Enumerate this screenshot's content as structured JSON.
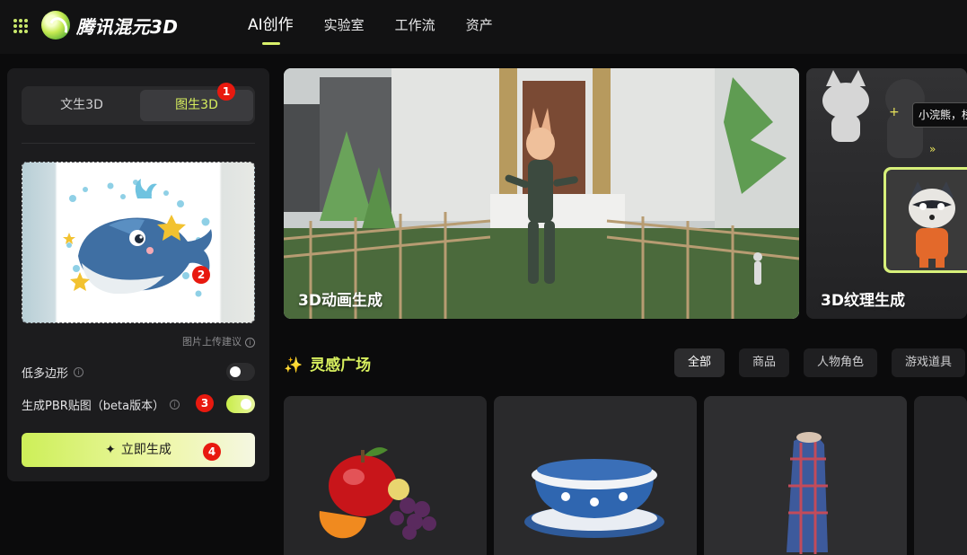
{
  "header": {
    "logo_text": "腾讯混元3D",
    "nav": [
      "AI创作",
      "实验室",
      "工作流",
      "资产"
    ]
  },
  "panel": {
    "tabs": [
      "文生3D",
      "图生3D"
    ],
    "active_tab": "图生3D",
    "upload_tip": "图片上传建议",
    "options": [
      {
        "label": "低多边形",
        "enabled": false
      },
      {
        "label": "生成PBR贴图（beta版本）",
        "enabled": true
      }
    ],
    "generate_label": "立即生成",
    "markers": [
      "1",
      "2",
      "3",
      "4"
    ]
  },
  "banners": [
    {
      "title": "3D动画生成"
    },
    {
      "title": "3D纹理生成",
      "prompt_preview": "小浣熊，桥",
      "plus": "+"
    }
  ],
  "gallery": {
    "title": "灵感广场",
    "filters": [
      "全部",
      "商品",
      "人物角色",
      "游戏道具"
    ],
    "active_filter": "全部"
  },
  "colors": {
    "accent": "#d7ef5e",
    "badge": "#e8190f",
    "background": "#0b0b0c",
    "panel": "#1c1c1e"
  }
}
